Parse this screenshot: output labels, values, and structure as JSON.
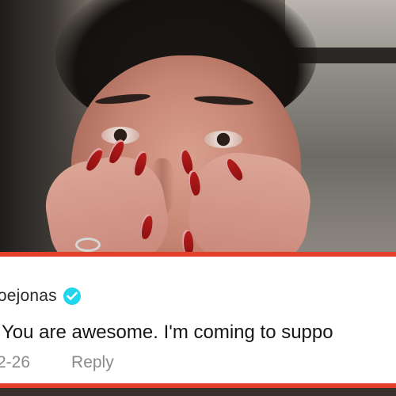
{
  "comment": {
    "username": "joejonas",
    "verified_icon": "verified-check-icon",
    "text": "You are awesome. I'm coming to suppo",
    "date": "2-26",
    "reply_label": "Reply"
  },
  "colors": {
    "card_border": "#e2402a",
    "verified_badge": "#20d5ec",
    "nail_polish": "#b81d1d"
  }
}
